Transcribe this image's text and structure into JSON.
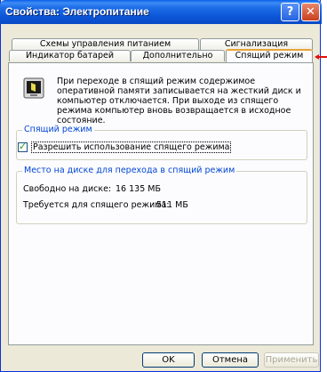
{
  "window": {
    "title": "Свойства: Электропитание",
    "help_glyph": "?",
    "close_glyph": "✕"
  },
  "tabs": {
    "row1": [
      "Схемы управления питанием",
      "Сигнализация"
    ],
    "row2": [
      "Индикатор батарей",
      "Дополнительно",
      "Спящий режим"
    ],
    "active": "Спящий режим"
  },
  "intro_text": "При переходе в спящий режим содержимое оперативной памяти записывается на жесткий диск и компьютер отключается. При выходе из спящего режима компьютер вновь возвращается в исходное состояние.",
  "sleep_group": {
    "legend": "Спящий режим",
    "checkbox_label": "Разрешить использование спящего режима",
    "checked": true
  },
  "disk_group": {
    "legend": "Место на диске для перехода в спящий режим",
    "free_label": "Свободно на диске:",
    "free_value": "16 135 МБ",
    "required_label": "Требуется для спящего режима:",
    "required_value": "511 МБ"
  },
  "buttons": {
    "ok": "OK",
    "cancel": "Отмена",
    "apply": "Применить"
  },
  "colors": {
    "titlebar": "#0a55d8",
    "group_legend": "#0046d5",
    "active_tab_accent": "#e9a23a",
    "pointer_arrow": "#e01010"
  },
  "icons": {
    "tab_pointer": "red-arrow-icon",
    "hibernate": "hibernate-computer-icon"
  }
}
